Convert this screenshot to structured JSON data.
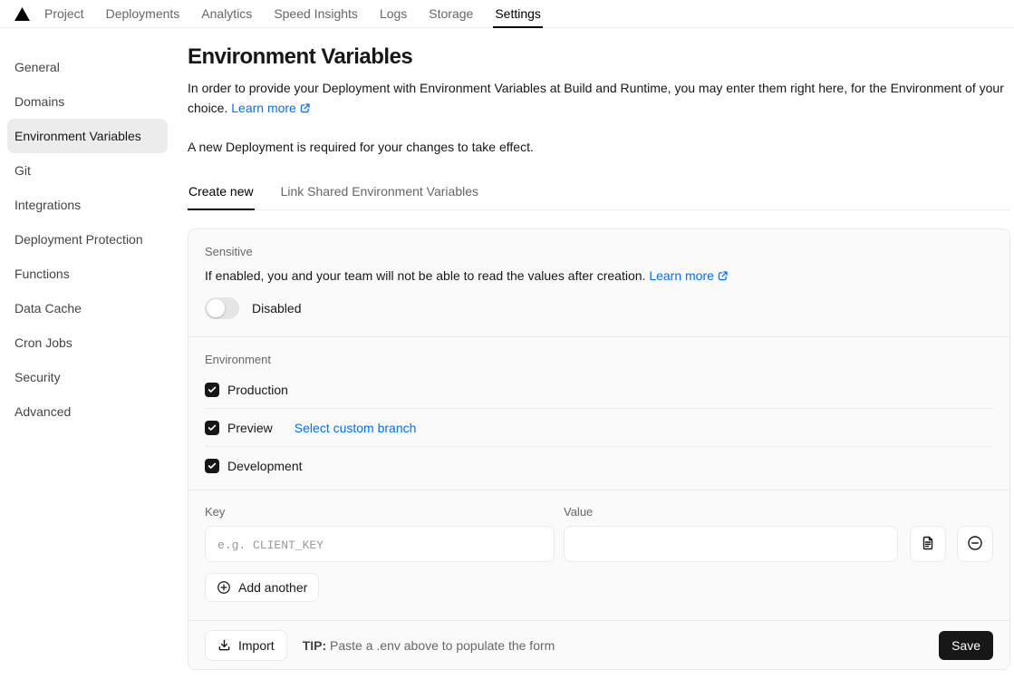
{
  "nav": {
    "items": [
      {
        "label": "Project"
      },
      {
        "label": "Deployments"
      },
      {
        "label": "Analytics"
      },
      {
        "label": "Speed Insights"
      },
      {
        "label": "Logs"
      },
      {
        "label": "Storage"
      },
      {
        "label": "Settings",
        "active": true
      }
    ]
  },
  "sidebar": {
    "items": [
      {
        "label": "General"
      },
      {
        "label": "Domains"
      },
      {
        "label": "Environment Variables",
        "active": true
      },
      {
        "label": "Git"
      },
      {
        "label": "Integrations"
      },
      {
        "label": "Deployment Protection"
      },
      {
        "label": "Functions"
      },
      {
        "label": "Data Cache"
      },
      {
        "label": "Cron Jobs"
      },
      {
        "label": "Security"
      },
      {
        "label": "Advanced"
      }
    ]
  },
  "page": {
    "title": "Environment Variables",
    "description": "In order to provide your Deployment with Environment Variables at Build and Runtime, you may enter them right here, for the Environment of your choice.",
    "learn_more_label": "Learn more",
    "notice": "A new Deployment is required for your changes to take effect."
  },
  "tabs": [
    {
      "label": "Create new",
      "active": true
    },
    {
      "label": "Link Shared Environment Variables"
    }
  ],
  "form": {
    "sensitive": {
      "label": "Sensitive",
      "description": "If enabled, you and your team will not be able to read the values after creation.",
      "learn_more_label": "Learn more",
      "toggle_state": "Disabled"
    },
    "environment": {
      "label": "Environment",
      "options": [
        {
          "label": "Production",
          "checked": true
        },
        {
          "label": "Preview",
          "checked": true,
          "link": "Select custom branch"
        },
        {
          "label": "Development",
          "checked": true
        }
      ]
    },
    "kv": {
      "key_label": "Key",
      "key_placeholder": "e.g. CLIENT_KEY",
      "key_value": "",
      "value_label": "Value",
      "value_value": "",
      "add_another_label": "Add another"
    },
    "footer": {
      "import_label": "Import",
      "tip_label": "TIP:",
      "tip_text": "Paste a .env above to populate the form",
      "save_label": "Save"
    }
  },
  "colors": {
    "accent_blue": "#0070f3",
    "text_black": "#171717",
    "text_gray": "#666666",
    "card_bg": "#fafafa",
    "border": "#eaeaea",
    "save_button_bg": "#171717"
  }
}
